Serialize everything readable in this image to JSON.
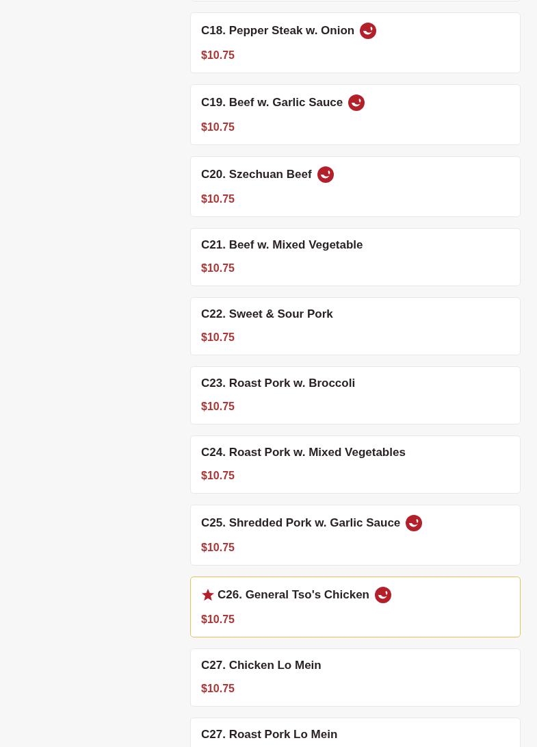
{
  "menu_items": [
    {
      "name": "C18. Pepper Steak w. Onion",
      "price": "$10.75",
      "spicy": true,
      "featured": false
    },
    {
      "name": "C19. Beef w. Garlic Sauce",
      "price": "$10.75",
      "spicy": true,
      "featured": false
    },
    {
      "name": "C20. Szechuan Beef",
      "price": "$10.75",
      "spicy": true,
      "featured": false
    },
    {
      "name": "C21. Beef w. Mixed Vegetable",
      "price": "$10.75",
      "spicy": false,
      "featured": false
    },
    {
      "name": "C22. Sweet & Sour Pork",
      "price": "$10.75",
      "spicy": false,
      "featured": false
    },
    {
      "name": "C23. Roast Pork w. Broccoli",
      "price": "$10.75",
      "spicy": false,
      "featured": false
    },
    {
      "name": "C24. Roast Pork w. Mixed Vegetables",
      "price": "$10.75",
      "spicy": false,
      "featured": false
    },
    {
      "name": "C25. Shredded Pork w. Garlic Sauce",
      "price": "$10.75",
      "spicy": true,
      "featured": false
    },
    {
      "name": "C26. General Tso's Chicken",
      "price": "$10.75",
      "spicy": true,
      "featured": true
    },
    {
      "name": "C27. Chicken Lo Mein",
      "price": "$10.75",
      "spicy": false,
      "featured": false
    },
    {
      "name": "C27. Roast Pork Lo Mein",
      "spicy": false,
      "featured": false
    }
  ]
}
